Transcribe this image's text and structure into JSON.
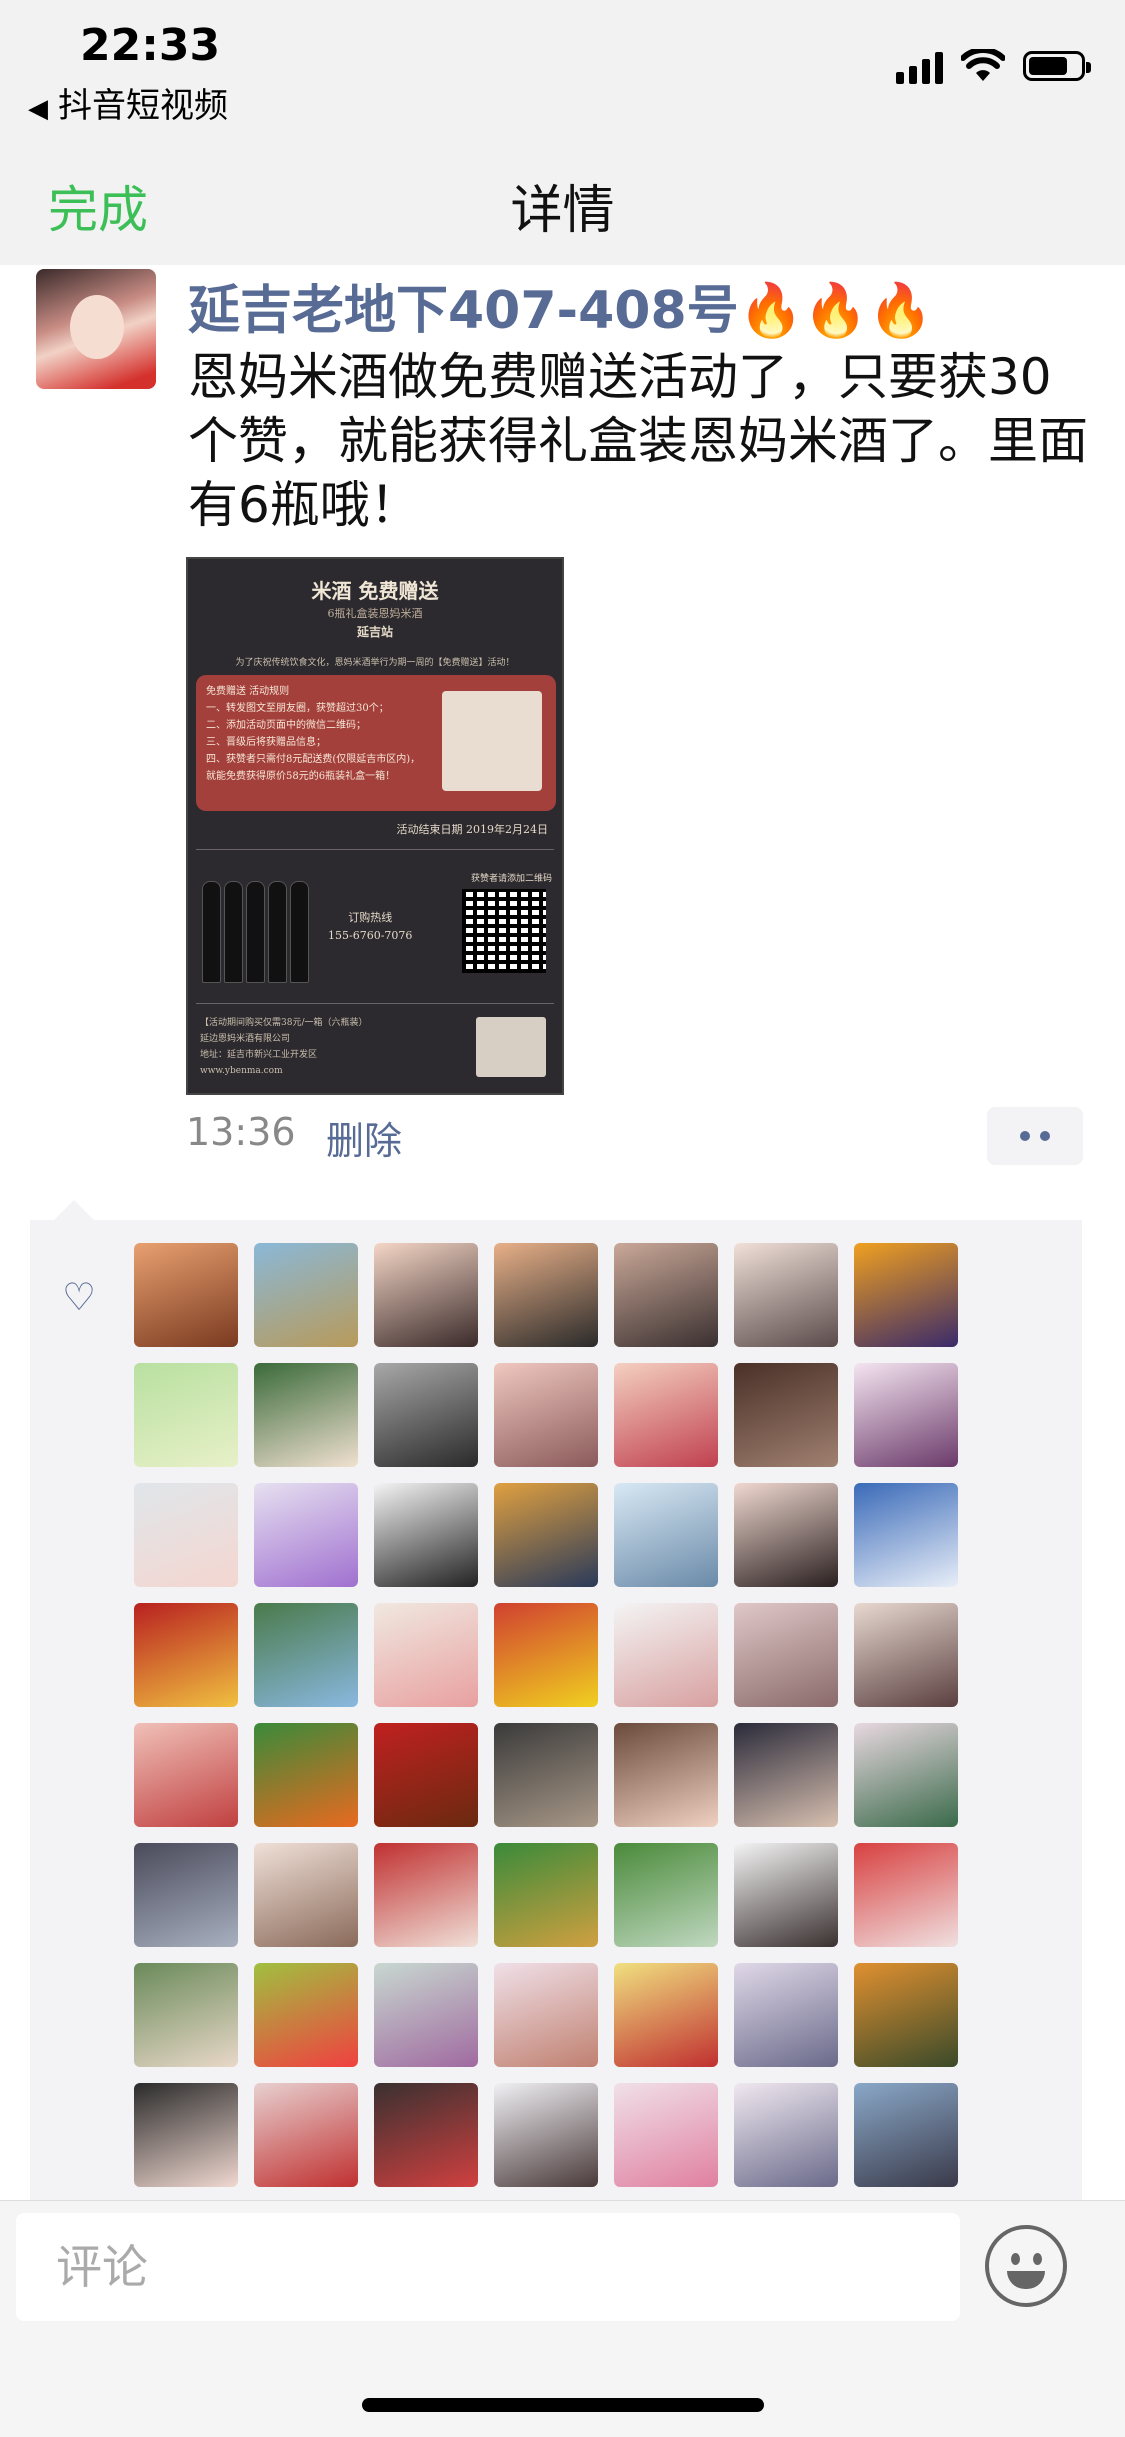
{
  "status_bar": {
    "time": "22:33",
    "back_app": "抖音短视频",
    "back_arrow": "◀"
  },
  "nav": {
    "done_label": "完成",
    "title": "详情"
  },
  "post": {
    "author": "延吉老地下407-408号🔥🔥🔥",
    "text": "恩妈米酒做免费赠送活动了，只要获30个赞，就能获得礼盒装恩妈米酒了。里面有6瓶哦！",
    "time": "13:36",
    "delete_label": "删除"
  },
  "poster": {
    "title": "米酒 免费赠送",
    "subtitle": "6瓶礼盒装恩妈米酒",
    "store": "延吉站",
    "intro": "为了庆祝传统饮食文化，恩妈米酒举行为期一周的【免费赠送】活动！",
    "rules": [
      "免费赠送 活动规则",
      "一、转发图文至朋友圈，获赞超过30个；",
      "二、添加活动页面中的微信二维码；",
      "三、晋级后将获赠品信息；",
      "四、获赞者只需付8元配送费(仅限延吉市区内)，",
      "就能免费获得原价58元的6瓶装礼盒一箱！"
    ],
    "end_date": "活动结束日期 2019年2月24日",
    "hotline_label": "订购热线",
    "hotline": "155-6760-7076",
    "qr_label": "获赞者请添加二维码",
    "footer": [
      "【活动期间购买仅需38元/一箱（六瓶装）",
      "延边恩妈米酒有限公司",
      "地址：延吉市新兴工业开发区",
      "www.ybenma.com"
    ]
  },
  "likes": {
    "icon": "heart-icon",
    "count": 56
  },
  "comment": {
    "placeholder": "评论"
  },
  "colors": {
    "link": "#576b95",
    "accent_green": "#3cbf57",
    "header_bg": "#f2f2f2",
    "likes_bg": "#f3f3f5"
  }
}
